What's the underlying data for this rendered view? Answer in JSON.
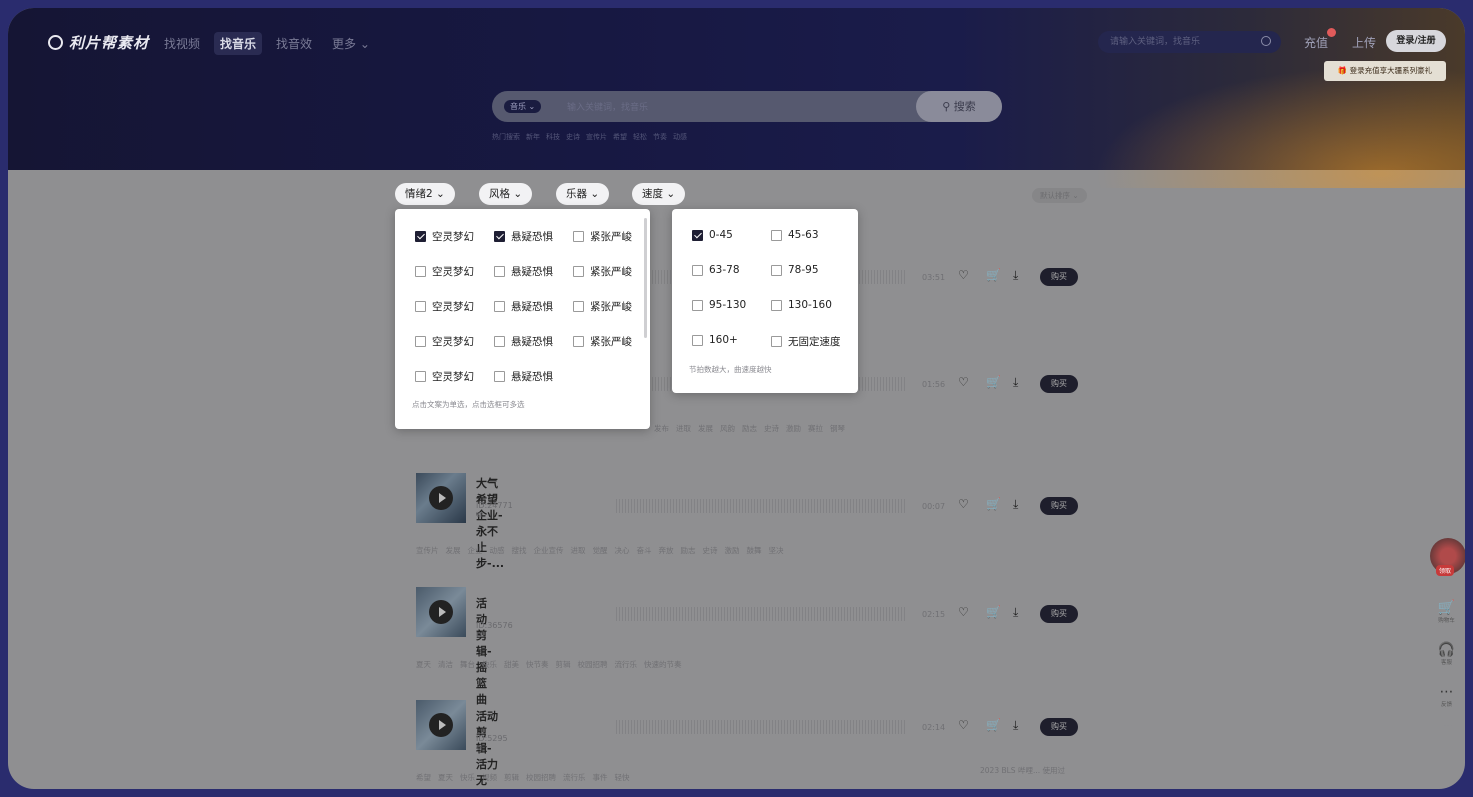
{
  "brand": {
    "logo": "利片帮素材"
  },
  "topnav": [
    {
      "label": "找视频",
      "active": false
    },
    {
      "label": "找音乐",
      "active": true
    },
    {
      "label": "找音效",
      "active": false
    },
    {
      "label": "更多 ⌄",
      "active": false
    }
  ],
  "top_search": {
    "placeholder": "请输入关键词，找音乐"
  },
  "header_actions": {
    "recharge": "充值",
    "upload": "上传",
    "login": "登录/注册",
    "promo": "登录充值享大疆系列豪礼"
  },
  "main_search": {
    "category": "音乐 ⌄",
    "placeholder": "输入关键词，找音乐",
    "button": "搜索"
  },
  "hot_search": {
    "label": "热门搜索",
    "words": [
      "新年",
      "科技",
      "史诗",
      "宣传片",
      "希望",
      "轻松",
      "节奏",
      "动感"
    ]
  },
  "filters": {
    "mood": "情绪2 ⌄",
    "style": "风格 ⌄",
    "instrument": "乐器 ⌄",
    "speed": "速度 ⌄",
    "sort": "默认排序 ⌄"
  },
  "mood_panel": {
    "options": [
      {
        "label": "空灵梦幻",
        "checked": true
      },
      {
        "label": "悬疑恐惧",
        "checked": true
      },
      {
        "label": "紧张严峻",
        "checked": false
      },
      {
        "label": "空灵梦幻",
        "checked": false
      },
      {
        "label": "悬疑恐惧",
        "checked": false
      },
      {
        "label": "紧张严峻",
        "checked": false
      },
      {
        "label": "空灵梦幻",
        "checked": false
      },
      {
        "label": "悬疑恐惧",
        "checked": false
      },
      {
        "label": "紧张严峻",
        "checked": false
      },
      {
        "label": "空灵梦幻",
        "checked": false
      },
      {
        "label": "悬疑恐惧",
        "checked": false
      },
      {
        "label": "紧张严峻",
        "checked": false
      },
      {
        "label": "空灵梦幻",
        "checked": false
      },
      {
        "label": "悬疑恐惧",
        "checked": false
      }
    ],
    "hint": "点击文案为单选，点击选框可多选"
  },
  "speed_panel": {
    "options": [
      {
        "label": "0-45",
        "checked": true
      },
      {
        "label": "45-63",
        "checked": false
      },
      {
        "label": "63-78",
        "checked": false
      },
      {
        "label": "78-95",
        "checked": false
      },
      {
        "label": "95-130",
        "checked": false
      },
      {
        "label": "130-160",
        "checked": false
      },
      {
        "label": "160+",
        "checked": false
      },
      {
        "label": "无固定速度",
        "checked": false
      }
    ],
    "hint": "节拍数越大，曲速度越快"
  },
  "tracks": [
    {
      "title": "",
      "id": "",
      "duration": "03:51",
      "buy": "购买",
      "tags": []
    },
    {
      "title": "",
      "id": "",
      "duration": "01:56",
      "buy": "购买",
      "tags": [
        "发布",
        "进取",
        "发展",
        "风韵",
        "励志",
        "史诗",
        "激励",
        "赛拉",
        "钢琴"
      ]
    },
    {
      "title": "大气希望企业-永不止步-...",
      "id": "ID:24771",
      "duration": "00:07",
      "buy": "购买",
      "tags": [
        "宣传片",
        "发展",
        "企业",
        "动感",
        "搜找",
        "企业宣传",
        "进取",
        "觉醒",
        "决心",
        "奋斗",
        "奔放",
        "励志",
        "史诗",
        "激励",
        "鼓舞",
        "坚决"
      ]
    },
    {
      "title": "活动剪辑-摇篮曲",
      "id": "ID:36576",
      "duration": "02:15",
      "buy": "购买",
      "tags": [
        "夏天",
        "清洁",
        "舞台",
        "快乐",
        "甜美",
        "快节奏",
        "剪辑",
        "校园招聘",
        "流行乐",
        "快速的节奏"
      ]
    },
    {
      "title": "活动剪辑-活力无限-电的...",
      "id": "ID:5295",
      "duration": "02:14",
      "buy": "购买",
      "tags": [
        "希望",
        "夏天",
        "快乐",
        "视频",
        "剪辑",
        "校园招聘",
        "流行乐",
        "事件",
        "轻快"
      ]
    }
  ],
  "footnote": "2023 BLS 哔哩... 使用过",
  "rail": {
    "badge": "领取",
    "cart": "购物车",
    "service": "客服",
    "feedback": "反馈"
  }
}
